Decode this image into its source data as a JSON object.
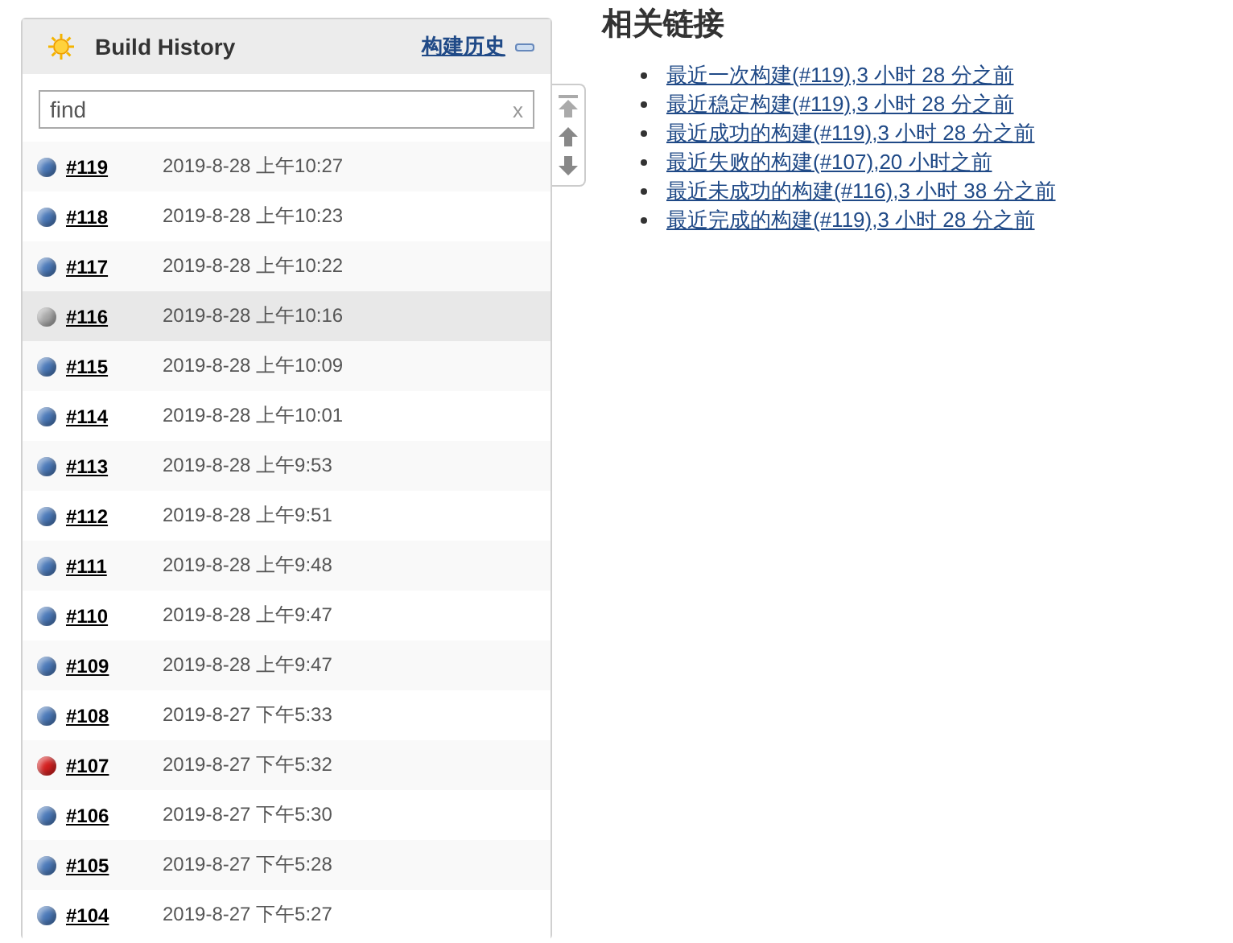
{
  "build_history": {
    "title": "Build History",
    "trend_link": "构建历史",
    "search": {
      "placeholder": "find",
      "clear": "x"
    },
    "builds": [
      {
        "number": "#119",
        "time": "2019-8-28 上午10:27",
        "color": "#4a78b8",
        "selected": false
      },
      {
        "number": "#118",
        "time": "2019-8-28 上午10:23",
        "color": "#4a78b8",
        "selected": false
      },
      {
        "number": "#117",
        "time": "2019-8-28 上午10:22",
        "color": "#4a78b8",
        "selected": false
      },
      {
        "number": "#116",
        "time": "2019-8-28 上午10:16",
        "color": "#a8a8a8",
        "selected": true
      },
      {
        "number": "#115",
        "time": "2019-8-28 上午10:09",
        "color": "#4a78b8",
        "selected": false
      },
      {
        "number": "#114",
        "time": "2019-8-28 上午10:01",
        "color": "#4a78b8",
        "selected": false
      },
      {
        "number": "#113",
        "time": "2019-8-28 上午9:53",
        "color": "#4a78b8",
        "selected": false
      },
      {
        "number": "#112",
        "time": "2019-8-28 上午9:51",
        "color": "#4a78b8",
        "selected": false
      },
      {
        "number": "#111",
        "time": "2019-8-28 上午9:48",
        "color": "#4a78b8",
        "selected": false
      },
      {
        "number": "#110",
        "time": "2019-8-28 上午9:47",
        "color": "#4a78b8",
        "selected": false
      },
      {
        "number": "#109",
        "time": "2019-8-28 上午9:47",
        "color": "#4a78b8",
        "selected": false
      },
      {
        "number": "#108",
        "time": "2019-8-27 下午5:33",
        "color": "#4a78b8",
        "selected": false
      },
      {
        "number": "#107",
        "time": "2019-8-27 下午5:32",
        "color": "#d42020",
        "selected": false
      },
      {
        "number": "#106",
        "time": "2019-8-27 下午5:30",
        "color": "#4a78b8",
        "selected": false
      },
      {
        "number": "#105",
        "time": "2019-8-27 下午5:28",
        "color": "#4a78b8",
        "selected": false
      },
      {
        "number": "#104",
        "time": "2019-8-27 下午5:27",
        "color": "#4a78b8",
        "selected": false
      }
    ]
  },
  "related_links": {
    "title": "相关链接",
    "links": [
      "最近一次构建(#119),3 小时 28 分之前",
      "最近稳定构建(#119),3 小时 28 分之前",
      "最近成功的构建(#119),3 小时 28 分之前",
      "最近失败的构建(#107),20 小时之前",
      "最近未成功的构建(#116),3 小时 38 分之前",
      "最近完成的构建(#119),3 小时 28 分之前"
    ]
  }
}
